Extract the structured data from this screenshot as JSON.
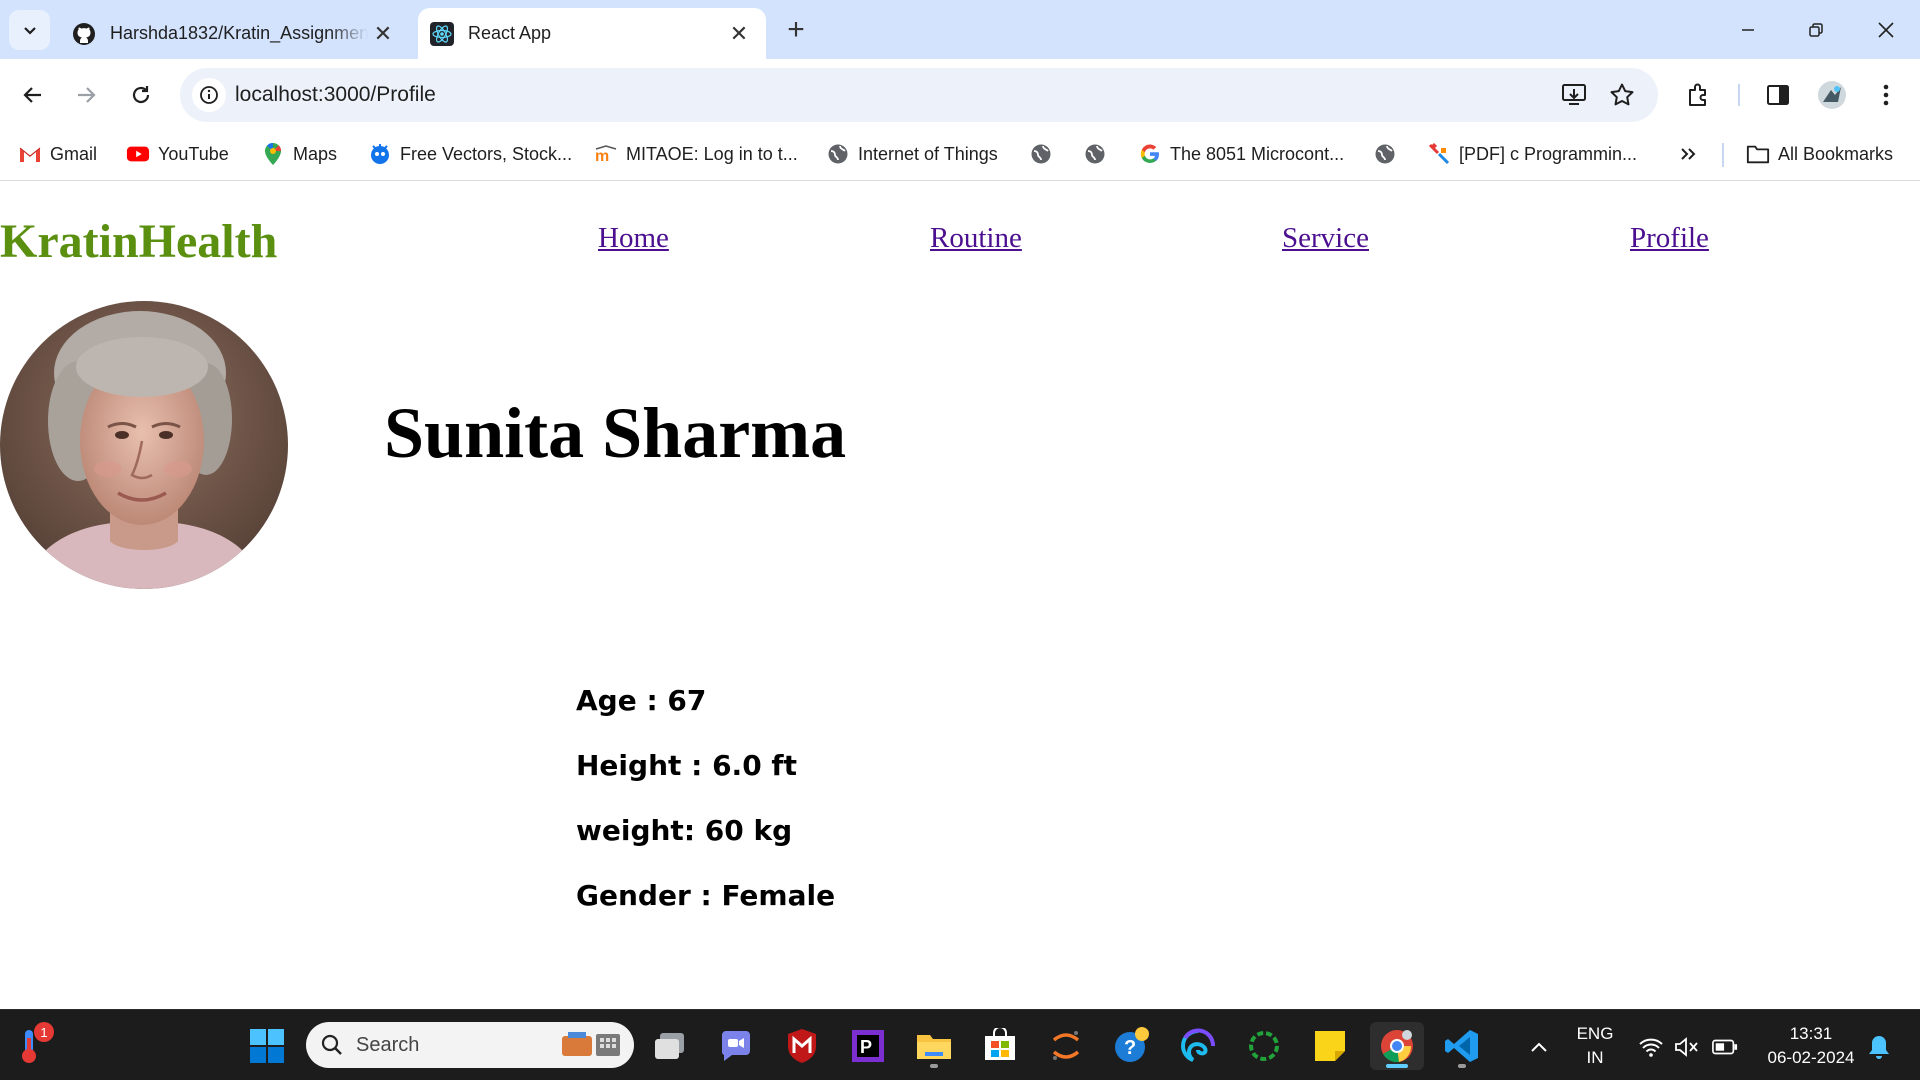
{
  "browser": {
    "tabs": [
      {
        "title": "Harshda1832/Kratin_Assignment",
        "icon": "github-icon",
        "active": false
      },
      {
        "title": "React App",
        "icon": "react-icon",
        "active": true
      }
    ],
    "address_bar": {
      "url": "localhost:3000/Profile"
    },
    "bookmarks": [
      {
        "label": "Gmail",
        "icon": "gmail-icon"
      },
      {
        "label": "YouTube",
        "icon": "youtube-icon"
      },
      {
        "label": "Maps",
        "icon": "maps-icon"
      },
      {
        "label": "Free Vectors, Stock...",
        "icon": "freepik-icon"
      },
      {
        "label": "MITAOE: Log in to t...",
        "icon": "moodle-icon"
      },
      {
        "label": "Internet of Things",
        "icon": "globe-icon"
      },
      {
        "label": "",
        "icon": "globe-icon"
      },
      {
        "label": "",
        "icon": "globe-icon"
      },
      {
        "label": "The 8051 Microcont...",
        "icon": "google-icon"
      },
      {
        "label": "",
        "icon": "globe-icon"
      },
      {
        "label": "[PDF] c Programmin...",
        "icon": "pdf-site-icon"
      }
    ],
    "all_bookmarks_label": "All Bookmarks"
  },
  "page": {
    "brand": "KratinHealth",
    "nav": [
      {
        "label": "Home"
      },
      {
        "label": "Routine"
      },
      {
        "label": "Service"
      },
      {
        "label": "Profile"
      }
    ],
    "profile": {
      "name": "Sunita Sharma",
      "details": [
        "Age : 67",
        "Height : 6.0 ft",
        "weight: 60 kg",
        "Gender : Female"
      ]
    },
    "colors": {
      "brand": "#5a8f0f",
      "link": "#4b0f8f"
    }
  },
  "taskbar": {
    "search_placeholder": "Search",
    "weather_badge": "1",
    "language": {
      "line1": "ENG",
      "line2": "IN"
    },
    "time": "13:31",
    "date": "06-02-2024"
  }
}
